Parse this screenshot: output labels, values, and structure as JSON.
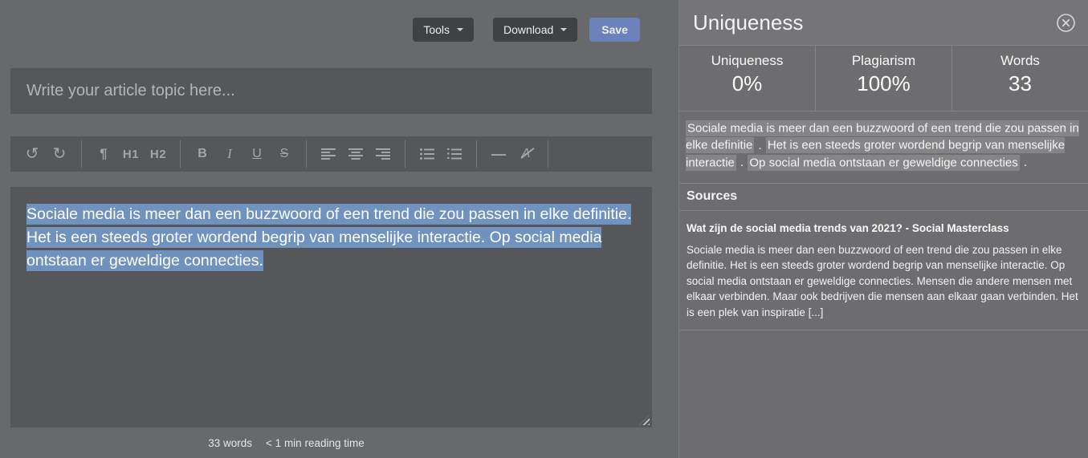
{
  "editor": {
    "top_actions": {
      "tools_label": "Tools",
      "download_label": "Download",
      "save_label": "Save"
    },
    "topic_placeholder": "Write your article topic here...",
    "format_toolbar": {
      "undo": "↺",
      "redo": "↻",
      "paragraph": "¶",
      "h1": "H1",
      "h2": "H2",
      "bold": "B",
      "italic": "I",
      "underline": "U",
      "strike": "S",
      "hr": "—",
      "clear_format": "A"
    },
    "content_selected": "Sociale media is meer dan een buzzwoord of een trend die zou passen in elke definitie. Het is een steeds groter wordend begrip van menselijke interactie. Op social media ontstaan er geweldige connecties.",
    "status": {
      "word_count": "33 words",
      "reading_time": "< 1 min reading time"
    }
  },
  "panel": {
    "title": "Uniqueness",
    "stats": [
      {
        "label": "Uniqueness",
        "value": "0%"
      },
      {
        "label": "Plagiarism",
        "value": "100%"
      },
      {
        "label": "Words",
        "value": "33"
      }
    ],
    "analysis": {
      "sentences": [
        "Sociale media is meer dan een buzzwoord of een trend die zou passen in elke definitie",
        "Het is een steeds groter wordend begrip van menselijke interactie",
        "Op social media ontstaan er geweldige connecties"
      ],
      "separator": " . "
    },
    "sources_title": "Sources",
    "source": {
      "title": "Wat zijn de social media trends van 2021? - Social Masterclass",
      "excerpt": "Sociale media is meer dan een buzzwoord of een trend die zou passen in elke definitie. Het is een steeds groter wordend begrip van menselijke interactie. Op social media ontstaan er geweldige connecties. Mensen die andere mensen met elkaar verbinden. Maar ook bedrijven die mensen aan elkaar gaan verbinden. Het is een plek van inspiratie [...]"
    }
  },
  "colors": {
    "accent_save": "#6d82ba",
    "text_selection": "#6f93be",
    "plagiarism_highlight": "#858587",
    "page_background": "#68696b",
    "field_background": "#56575a",
    "panel_background": "#6d6d6f"
  }
}
